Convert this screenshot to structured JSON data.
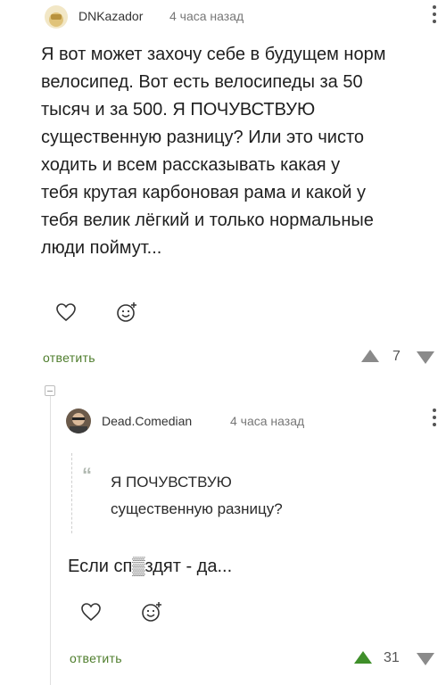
{
  "comment1": {
    "author": "DNKazador",
    "time": "4 часа назад",
    "text_lines": [
      "Я вот может захочу себе в будущем норм",
      "велосипед. Вот есть велосипеды за 50",
      "тысяч и за 500. Я ПОЧУВСТВУЮ",
      "существенную разницу? Или это чисто",
      "ходить и всем рассказывать какая у",
      "тебя крутая карбоновая рама и какой у",
      "тебя велик лёгкий и только нормальные",
      "люди поймут..."
    ],
    "reply_label": "ответить",
    "votes": "7"
  },
  "comment2": {
    "author": "Dead.Comedian",
    "time": "4 часа назад",
    "quote_lines": [
      "Я ПОЧУВСТВУЮ",
      "существенную разницу?"
    ],
    "text": "Если сп▒здят - да...",
    "reply_label": "ответить",
    "votes": "31"
  },
  "colors": {
    "reply_green": "#4e7d2c",
    "upvote_active": "#3f8f2a",
    "vote_gray": "#8a8a8a"
  },
  "icons": [
    "avatar",
    "heart-icon",
    "emoji-add-icon",
    "upvote-icon",
    "downvote-icon",
    "kebab-menu-icon",
    "collapse-icon",
    "quote-icon"
  ]
}
